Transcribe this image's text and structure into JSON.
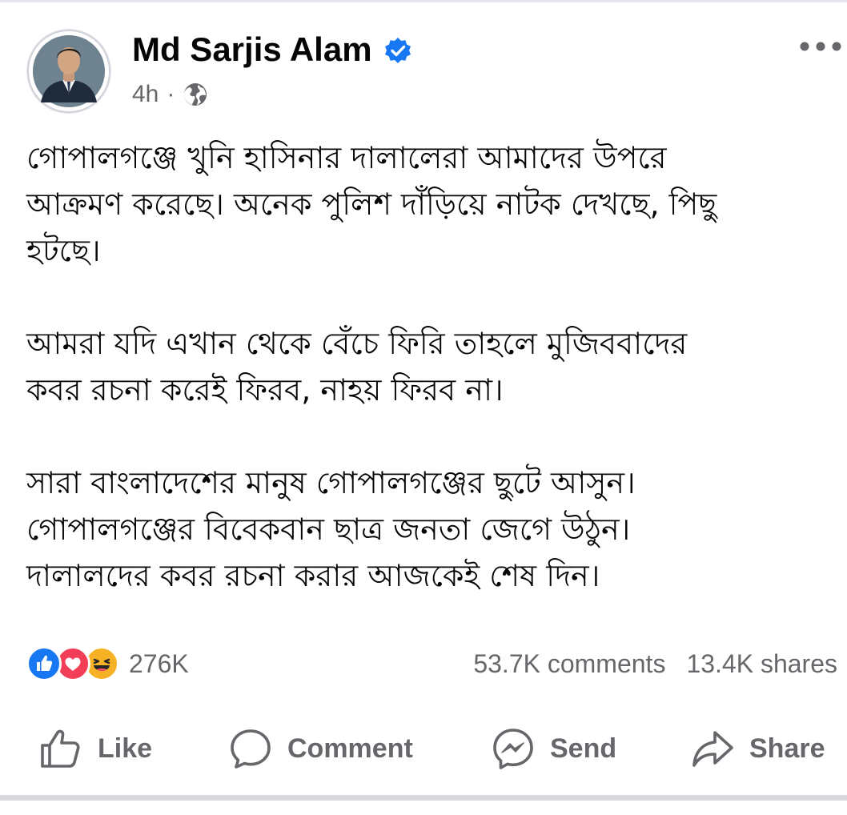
{
  "post": {
    "author": {
      "name": "Md Sarjis Alam",
      "verified": true,
      "avatar_icon": "profile-photo"
    },
    "meta": {
      "time": "4h",
      "separator": "·",
      "audience_icon": "globe-icon"
    },
    "paragraphs": [
      "গোপালগঞ্জে খুনি হাসিনার দালালেরা আমাদের উপরে\nআক্রমণ করেছে। অনেক পুলিশ দাঁড়িয়ে নাটক দেখছে, পিছু\nহটছে।",
      "আমরা যদি এখান থেকে বেঁচে ফিরি তাহলে মুজিববাদের\nকবর রচনা করেই ফিরব, নাহয় ফিরব না।",
      "সারা বাংলাদেশের মানুষ গোপালগঞ্জের ছুটে আসুন।\nগোপালগঞ্জের বিবেকবান ছাত্র জনতা জেগে উঠুন।\nদালালদের কবর রচনা করার আজকেই শেষ দিন।"
    ],
    "reactions": {
      "icons": [
        "like-reaction-icon",
        "love-reaction-icon",
        "haha-reaction-icon"
      ],
      "count": "276K"
    },
    "stats": {
      "comments": "53.7K comments",
      "shares": "13.4K shares"
    }
  },
  "actions": {
    "like": "Like",
    "comment": "Comment",
    "send": "Send",
    "share": "Share"
  },
  "colors": {
    "text_primary": "#050505",
    "text_secondary": "#65676b",
    "verified_blue": "#1877f2",
    "like_blue": "#1877f2",
    "love_red": "#f33e58",
    "haha_yellow": "#f7b125"
  }
}
